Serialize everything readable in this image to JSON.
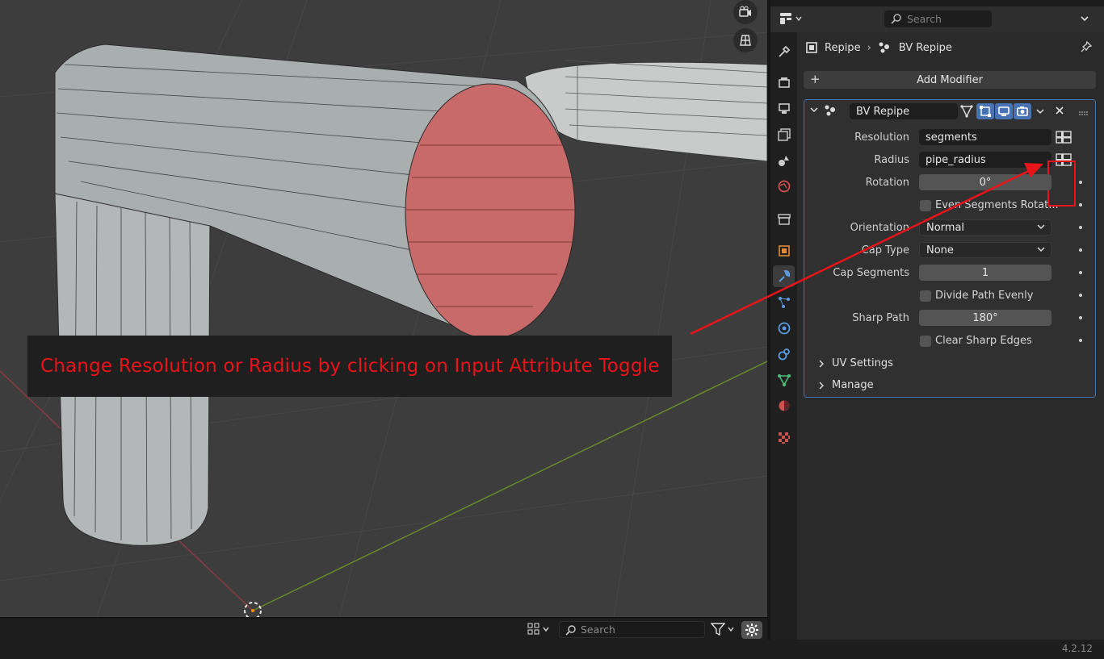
{
  "annotation": {
    "text": "Change Resolution or Radius by clicking on Input Attribute Toggle",
    "color": "#e8141a"
  },
  "viewport": {
    "footer_search_placeholder": "Search",
    "icons": [
      "camera-view-icon",
      "grid-view-icon",
      "editor-layout-icon",
      "filter-icon",
      "gear-icon"
    ]
  },
  "properties": {
    "search_placeholder": "Search",
    "breadcrumb": {
      "object": "Repipe",
      "modifier": "BV Repipe"
    },
    "add_modifier_label": "Add Modifier",
    "accent_color": "#4772b3",
    "modifier": {
      "name": "BV Repipe",
      "rows": {
        "resolution": {
          "label": "Resolution",
          "value": "segments"
        },
        "radius": {
          "label": "Radius",
          "value": "pipe_radius"
        },
        "rotation": {
          "label": "Rotation",
          "value": "0°"
        },
        "even_segments": {
          "label": "Even Segments Rotat..."
        },
        "orientation": {
          "label": "Orientation",
          "value": "Normal"
        },
        "cap_type": {
          "label": "Cap Type",
          "value": "None"
        },
        "cap_segments": {
          "label": "Cap Segments",
          "value": "1"
        },
        "divide_path": {
          "label": "Divide Path Evenly"
        },
        "sharp_path": {
          "label": "Sharp Path",
          "value": "180°"
        },
        "clear_sharp": {
          "label": "Clear Sharp Edges"
        }
      },
      "subpanels": [
        "UV Settings",
        "Manage"
      ]
    }
  },
  "status": {
    "version": "4.2.12"
  }
}
